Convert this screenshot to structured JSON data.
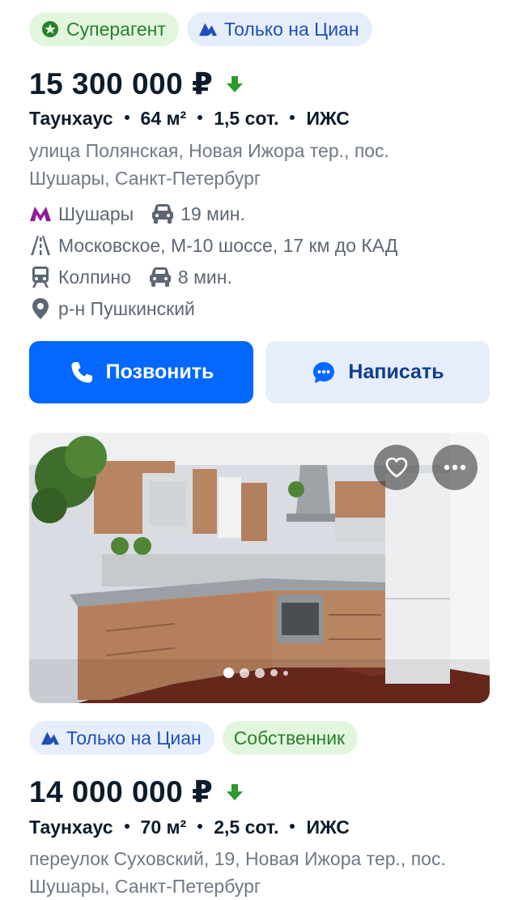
{
  "listing1": {
    "badges": [
      "Суперагент",
      "Только на Циан"
    ],
    "price": "15 300 000 ₽",
    "specs": [
      "Таунхаус",
      "64 м²",
      "1,5 сот.",
      "ИЖС"
    ],
    "address_line1": "улица Полянская, Новая Ижора тер., пос.",
    "address_line2": "Шушары, Санкт-Петербург",
    "metro": {
      "name": "Шушары",
      "time": "19 мин."
    },
    "highway": "Московское, М-10 шоссе, 17 км до КАД",
    "railway": {
      "name": "Колпино",
      "time": "8 мин."
    },
    "district": "р-н Пушкинский",
    "call_label": "Позвонить",
    "write_label": "Написать"
  },
  "gallery": {
    "image_count_dots": 5,
    "active_dot": 1
  },
  "listing2": {
    "badges": [
      "Только на Циан",
      "Собственник"
    ],
    "price": "14 000 000 ₽",
    "specs": [
      "Таунхаус",
      "70 м²",
      "2,5 сот.",
      "ИЖС"
    ],
    "address_line1": "переулок Суховский, 19, Новая Ижора тер., пос.",
    "address_line2": "Шушары, Санкт-Петербург"
  },
  "colors": {
    "accent": "#0468ff",
    "price_drop": "#2e9a2e",
    "metro": "#8e1d9a",
    "superagent_green": "#2a7f2c",
    "badge_blue": "#1f4fb8"
  },
  "icons": [
    "star-badge-icon",
    "cian-logo-icon",
    "price-down-icon",
    "metro-icon",
    "car-icon",
    "highway-icon",
    "train-icon",
    "location-pin-icon",
    "phone-icon",
    "chat-icon",
    "heart-icon",
    "more-icon"
  ]
}
